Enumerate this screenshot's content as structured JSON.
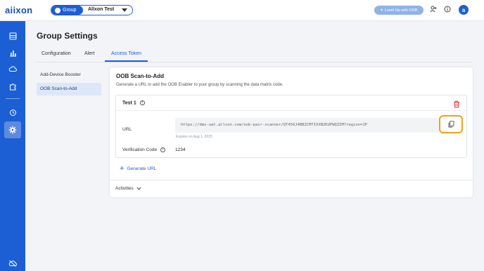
{
  "header": {
    "logo": "aiixon",
    "group_label": "Group",
    "group_name": "Allxon Test",
    "oob_button": "Level Up with OOB",
    "user_initial": "a"
  },
  "sidebar": {
    "items": [
      "storage-icon",
      "chart-icon",
      "cloud-icon",
      "puzzle-icon",
      "history-icon",
      "settings-icon",
      "cloud-off-icon"
    ],
    "active": "settings-icon"
  },
  "page": {
    "title": "Group Settings",
    "tabs": [
      "Configuration",
      "Alert",
      "Access Token"
    ],
    "active_tab": "Access Token"
  },
  "subnav": {
    "items": [
      "Add-Device Booster",
      "OOB Scan-to-Add"
    ],
    "active": "OOB Scan-to-Add"
  },
  "card": {
    "title": "OOB Scan-to-Add",
    "subtitle": "Generate a URL to add the OOB Enabler to your group by scanning the data matrix code.",
    "token": {
      "name": "Test 1",
      "url_label": "URL",
      "url_value": "https://dms-uat.allxon.com/oob-pair-scanner/QT456J4BBZCM7IXXN2KUPWQZIM?region=JP",
      "expires": "Expires on Aug 1, 2025",
      "verification_label": "Verification Code",
      "verification_value": "1234"
    },
    "generate_label": "Generate URL",
    "activities_label": "Activities"
  },
  "colors": {
    "brand": "#1c5fd4",
    "highlight": "#f0a020",
    "delete": "#e03030"
  }
}
